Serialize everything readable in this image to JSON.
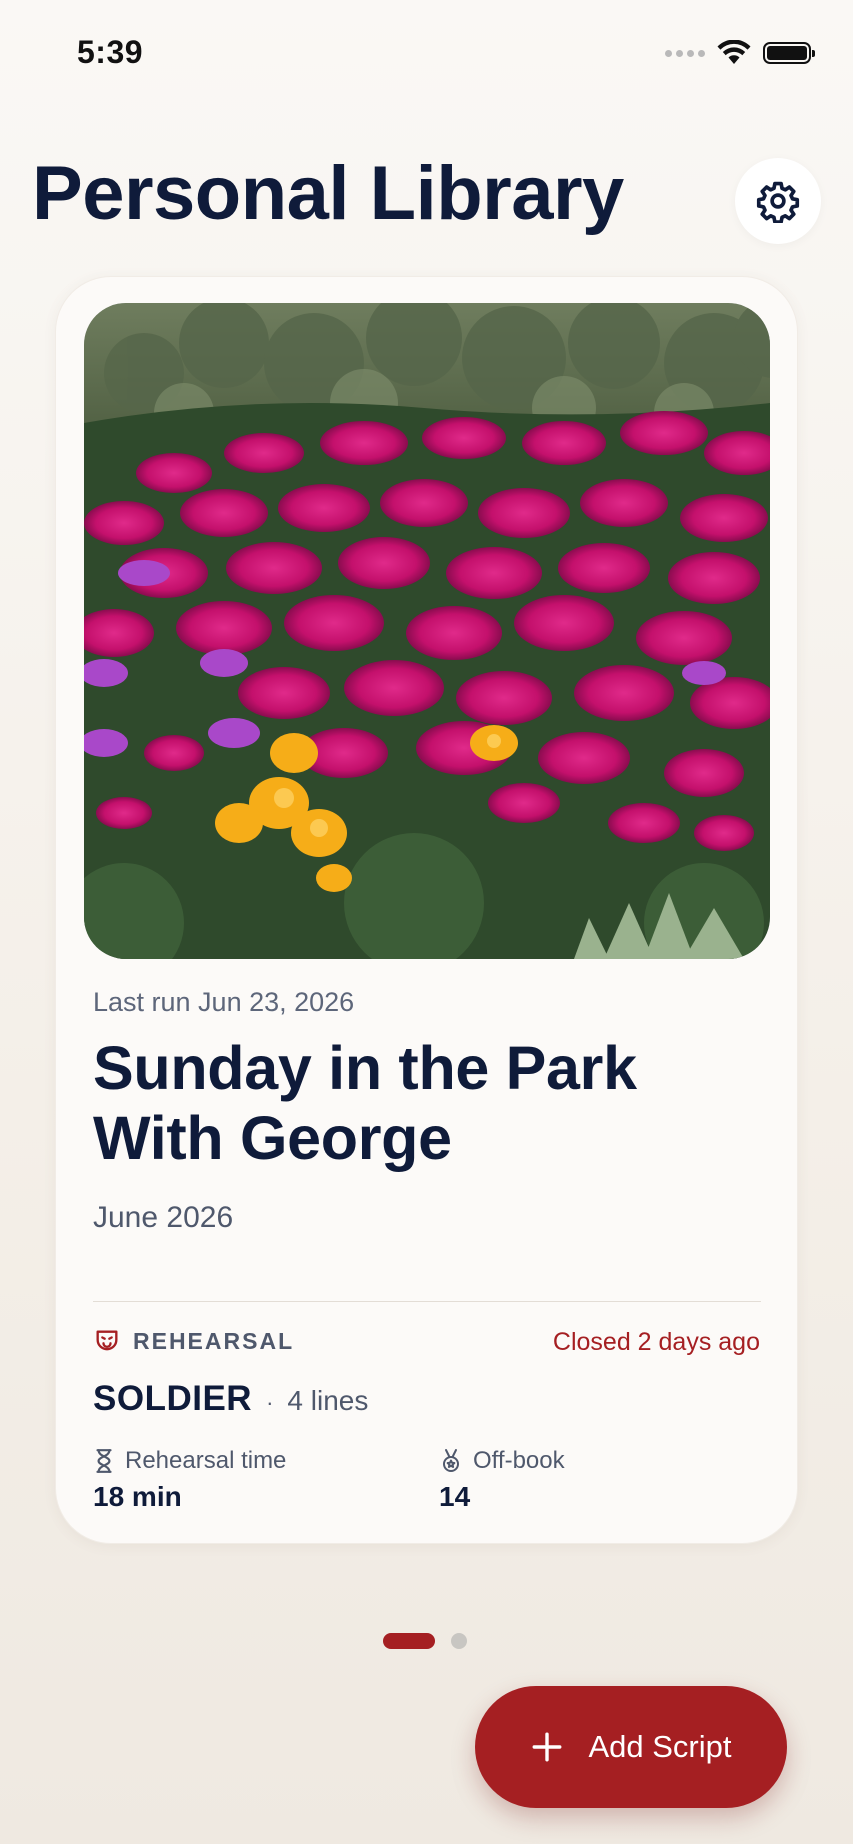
{
  "status_bar": {
    "time": "5:39"
  },
  "header": {
    "title": "Personal Library"
  },
  "card": {
    "last_run": "Last run Jun 23, 2026",
    "title": "Sunday in the Park With George",
    "date": "June 2026",
    "mode_label": "REHEARSAL",
    "status": "Closed 2 days ago",
    "role": "SOLDIER",
    "separator": "·",
    "lines": "4 lines",
    "stats": [
      {
        "label": "Rehearsal time",
        "value": "18 min",
        "icon": "hourglass-icon"
      },
      {
        "label": "Off-book",
        "value": "14",
        "icon": "medal-icon"
      }
    ]
  },
  "pagination": {
    "total": 2,
    "current": 1
  },
  "fab": {
    "label": "Add Script"
  },
  "colors": {
    "accent": "#a51f22",
    "title": "#0f1b3a",
    "muted": "#4f586c"
  }
}
